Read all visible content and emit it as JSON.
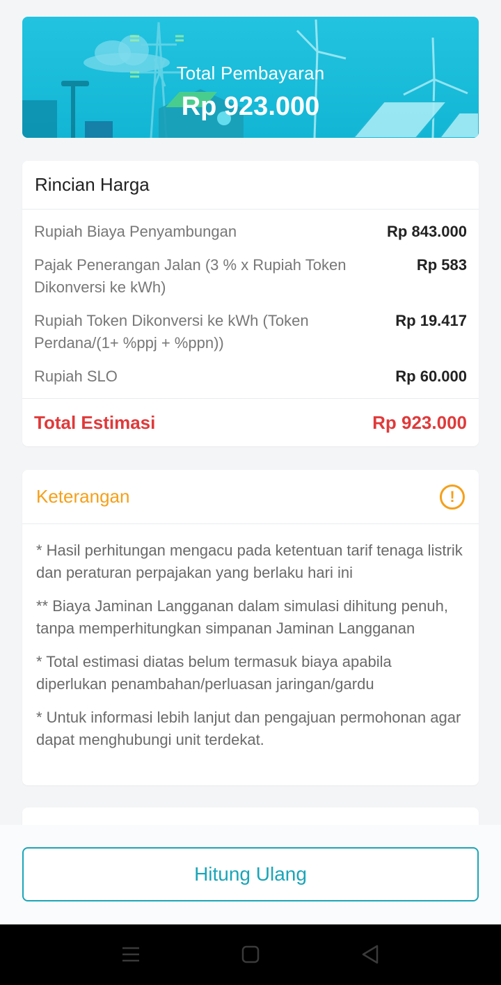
{
  "banner": {
    "title": "Total Pembayaran",
    "amount": "Rp 923.000"
  },
  "rincian": {
    "heading": "Rincian Harga",
    "rows": [
      {
        "label": "Rupiah Biaya Penyambungan",
        "value": "Rp 843.000"
      },
      {
        "label": "Pajak Penerangan Jalan (3 % x Rupiah Token Dikonversi ke kWh)",
        "value": "Rp 583"
      },
      {
        "label": "Rupiah Token Dikonversi ke kWh (Token Perdana/(1+ %ppj + %ppn))",
        "value": "Rp 19.417"
      },
      {
        "label": "Rupiah SLO",
        "value": "Rp 60.000"
      }
    ],
    "total_label": "Total Estimasi",
    "total_value": "Rp 923.000"
  },
  "keterangan": {
    "heading": "Keterangan",
    "icon": "warning-circle-icon",
    "notes": [
      "* Hasil perhitungan mengacu pada ketentuan tarif tenaga listrik dan peraturan perpajakan yang berlaku hari ini",
      "** Biaya Jaminan Langganan dalam simulasi dihitung penuh, tanpa memperhitungkan simpanan Jaminan Langganan",
      "* Total estimasi diatas belum termasuk biaya apabila diperlukan penambahan/perluasan jaringan/gardu",
      "* Untuk informasi lebih lanjut dan pengajuan permohonan agar dapat menghubungi unit terdekat."
    ]
  },
  "actions": {
    "recalc_label": "Hitung Ulang"
  },
  "colors": {
    "accent": "#1aa5b8",
    "banner": "#16bcd9",
    "total": "#e0393a",
    "warning": "#f5a01a"
  },
  "navbar": {
    "icons": [
      "menu-icon",
      "home-square-icon",
      "back-triangle-icon"
    ]
  }
}
